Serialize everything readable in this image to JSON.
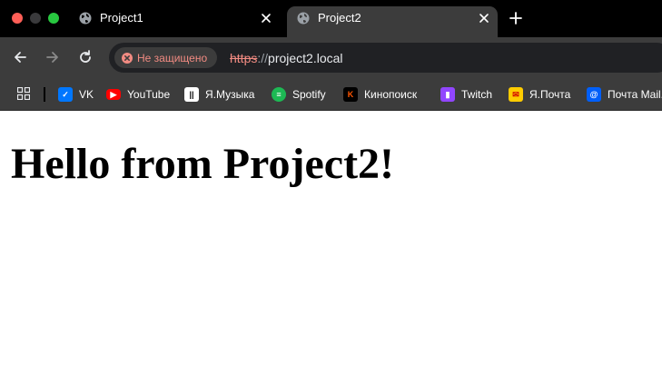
{
  "browser": {
    "tabs": [
      {
        "title": "Project1",
        "active": false
      },
      {
        "title": "Project2",
        "active": true
      }
    ],
    "security_label": "Не защищено",
    "url": {
      "scheme": "https",
      "separator": "://",
      "host": "project2.local"
    },
    "bookmarks": [
      {
        "label": "VK",
        "icon": "vk-icon",
        "color": "#0077ff"
      },
      {
        "label": "YouTube",
        "icon": "youtube-icon",
        "color": "#ff0000"
      },
      {
        "label": "Я.Музыка",
        "icon": "yandex-music-icon",
        "color": "#ffffff"
      },
      {
        "label": "Spotify",
        "icon": "spotify-icon",
        "color": "#1db954"
      },
      {
        "label": "Кинопоиск",
        "icon": "kinopoisk-icon",
        "color": "#ff5500"
      },
      {
        "label": "Twitch",
        "icon": "twitch-icon",
        "color": "#9146ff"
      },
      {
        "label": "Я.Почта",
        "icon": "yandex-mail-icon",
        "color": "#ffcc00"
      },
      {
        "label": "Почта Mail.ru",
        "icon": "mailru-icon",
        "color": "#005ff9"
      }
    ]
  },
  "page": {
    "heading": "Hello from Project2!"
  }
}
